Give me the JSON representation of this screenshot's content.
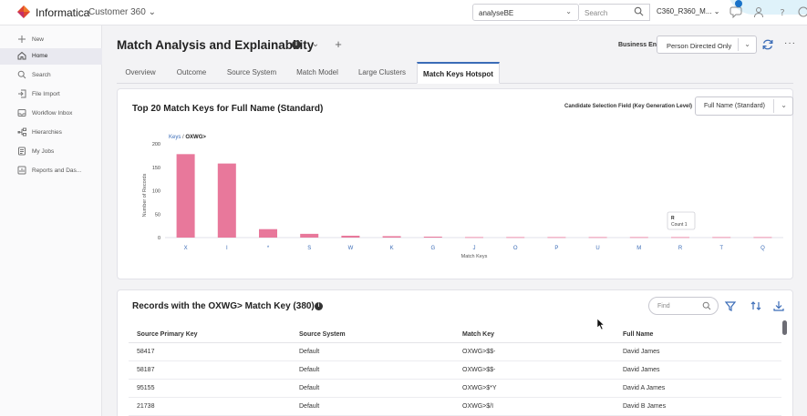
{
  "topbar": {
    "brand": "Informatica",
    "product": "Customer 360 ⌄",
    "org_value": "analyseBE",
    "search_placeholder": "Search",
    "env_value": "C360_R360_M... ⌄",
    "colors": {
      "accent": "#3b6cb7",
      "logo": "#e0462f"
    }
  },
  "sidebar": {
    "items": [
      {
        "label": "New",
        "icon": "plus-icon"
      },
      {
        "label": "Home",
        "icon": "home-icon"
      },
      {
        "label": "Search",
        "icon": "search-icon"
      },
      {
        "label": "File Import",
        "icon": "file-import-icon"
      },
      {
        "label": "Workflow Inbox",
        "icon": "inbox-icon"
      },
      {
        "label": "Hierarchies",
        "icon": "hierarchy-icon"
      },
      {
        "label": "My Jobs",
        "icon": "jobs-icon"
      },
      {
        "label": "Reports and Das...",
        "icon": "reports-icon"
      }
    ]
  },
  "page": {
    "title": "Match Analysis and Explainability",
    "info": "i",
    "business_entity_label": "Business Entity:",
    "business_entity_value": "Person Directed Only"
  },
  "tabs": [
    {
      "label": "Overview"
    },
    {
      "label": "Outcome"
    },
    {
      "label": "Source System"
    },
    {
      "label": "Match Model"
    },
    {
      "label": "Large Clusters"
    },
    {
      "label": "Match Keys Hotspot"
    }
  ],
  "chart_card": {
    "title": "Top 20 Match Keys for Full Name (Standard)",
    "csf_label": "Candidate Selection Field (Key Generation Level)",
    "csf_value": "Full Name (Standard)",
    "crumb_root": "Keys",
    "crumb_sep": "/",
    "crumb_current": "OXWG>"
  },
  "chart_data": {
    "type": "bar",
    "categories": [
      "X",
      "I",
      "*",
      "S",
      "W",
      "K",
      "G",
      "J",
      "O",
      "P",
      "U",
      "M",
      "R",
      "T",
      "Q"
    ],
    "values": [
      178,
      158,
      18,
      8,
      4,
      3,
      2,
      1,
      1,
      1,
      1,
      1,
      1,
      1,
      1
    ],
    "xlabel": "Match Keys",
    "ylabel": "Number of Records",
    "yticks": [
      0,
      50,
      100,
      150,
      200
    ],
    "ylim": [
      0,
      200
    ],
    "bar_color": "#e8789b",
    "grid": false,
    "tooltip": {
      "key": "R",
      "text": "Count 1"
    }
  },
  "records_card": {
    "title": "Records with the OXWG> Match Key (380)",
    "info": "i",
    "find_placeholder": "Find",
    "columns": [
      "Source Primary Key",
      "Source System",
      "Match Key",
      "Full Name"
    ],
    "rows": [
      [
        "58417",
        "Default",
        "OXWG>$$-",
        "David James"
      ],
      [
        "58187",
        "Default",
        "OXWG>$$-",
        "David James"
      ],
      [
        "95155",
        "Default",
        "OXWG>$*Y",
        "David A James"
      ],
      [
        "21738",
        "Default",
        "OXWG>$/I",
        "David B James"
      ]
    ]
  }
}
